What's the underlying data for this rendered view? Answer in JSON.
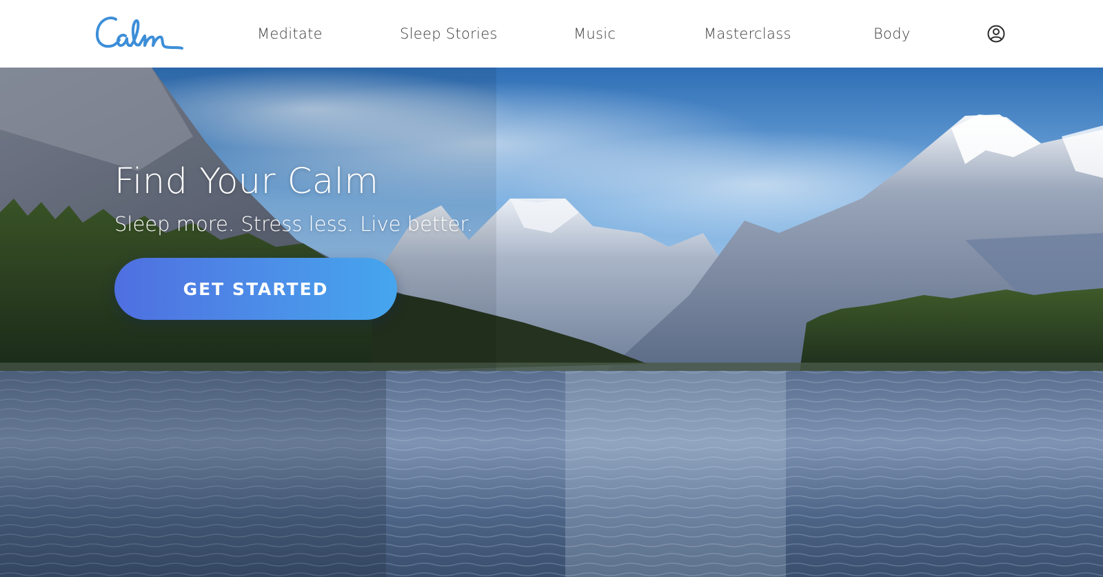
{
  "brand": {
    "name": "Calm",
    "color": "#3d8ed8"
  },
  "nav": {
    "items": [
      {
        "label": "Meditate"
      },
      {
        "label": "Sleep Stories"
      },
      {
        "label": "Music"
      },
      {
        "label": "Masterclass"
      },
      {
        "label": "Body"
      }
    ],
    "account_icon": "user-circle-icon"
  },
  "hero": {
    "title": "Find Your Calm",
    "subtitle": "Sleep more. Stress less. Live better.",
    "cta_label": "GET STARTED",
    "cta_colors": [
      "#4f6fe0",
      "#45a6ee"
    ],
    "background": "mountain-lake-photo"
  }
}
